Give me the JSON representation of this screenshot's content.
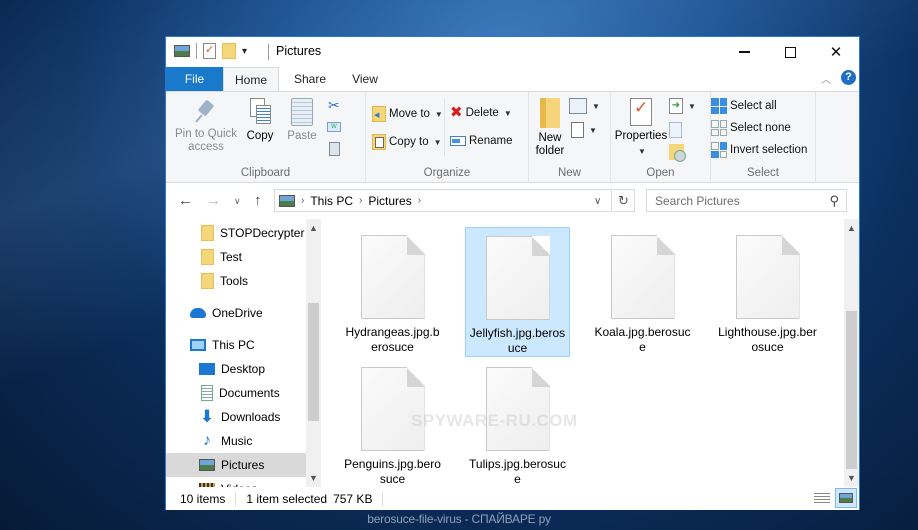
{
  "window": {
    "title": "Pictures",
    "controls": {
      "minimize": "minimize",
      "maximize": "maximize",
      "close": "close"
    }
  },
  "ribbon_tabs": [
    {
      "label": "File",
      "active": false
    },
    {
      "label": "Home",
      "active": true
    },
    {
      "label": "Share",
      "active": false
    },
    {
      "label": "View",
      "active": false
    }
  ],
  "ribbon": {
    "help_label": "?",
    "clipboard": {
      "label": "Clipboard",
      "pin_line1": "Pin to Quick",
      "pin_line2": "access",
      "copy": "Copy",
      "paste": "Paste"
    },
    "organize": {
      "label": "Organize",
      "move_to": "Move to",
      "copy_to": "Copy to",
      "delete": "Delete",
      "rename": "Rename"
    },
    "new": {
      "label": "New",
      "new_folder_line1": "New",
      "new_folder_line2": "folder"
    },
    "open": {
      "label": "Open",
      "properties": "Properties"
    },
    "select": {
      "label": "Select",
      "select_all": "Select all",
      "select_none": "Select none",
      "invert_selection": "Invert selection"
    }
  },
  "address": {
    "path": [
      "This PC",
      "Pictures"
    ],
    "search_placeholder": "Search Pictures"
  },
  "nav_pane": {
    "items": [
      {
        "label": "STOPDecrypter",
        "icon": "folder-icon",
        "selected": false
      },
      {
        "label": "Test",
        "icon": "folder-icon",
        "selected": false
      },
      {
        "label": "Tools",
        "icon": "folder-icon",
        "selected": false
      },
      {
        "label": "OneDrive",
        "icon": "onedrive-icon",
        "selected": false
      },
      {
        "label": "This PC",
        "icon": "computer-icon",
        "selected": false
      },
      {
        "label": "Desktop",
        "icon": "desktop-icon",
        "selected": false
      },
      {
        "label": "Documents",
        "icon": "documents-icon",
        "selected": false
      },
      {
        "label": "Downloads",
        "icon": "downloads-icon",
        "selected": false
      },
      {
        "label": "Music",
        "icon": "music-icon",
        "selected": false
      },
      {
        "label": "Pictures",
        "icon": "pictures-icon",
        "selected": true
      },
      {
        "label": "Videos",
        "icon": "videos-icon",
        "selected": false
      }
    ]
  },
  "files": [
    {
      "name": "Hydrangeas.jpg.berosuce",
      "selected": false
    },
    {
      "name": "Jellyfish.jpg.berosuce",
      "selected": true
    },
    {
      "name": "Koala.jpg.berosuce",
      "selected": false
    },
    {
      "name": "Lighthouse.jpg.berosuce",
      "selected": false
    },
    {
      "name": "Penguins.jpg.berosuce",
      "selected": false
    },
    {
      "name": "Tulips.jpg.berosuce",
      "selected": false
    }
  ],
  "status": {
    "item_count": "10 items",
    "selection": "1 item selected",
    "size": "757 KB"
  },
  "watermark": "SPYWARE-RU.COM",
  "caption": "berosuce-file-virus - СПАЙВАРЕ ру",
  "colors": {
    "accent": "#1979ca",
    "selection_bg": "#cce8ff",
    "selection_border": "#99d1ff",
    "delete_red": "#d42020"
  }
}
